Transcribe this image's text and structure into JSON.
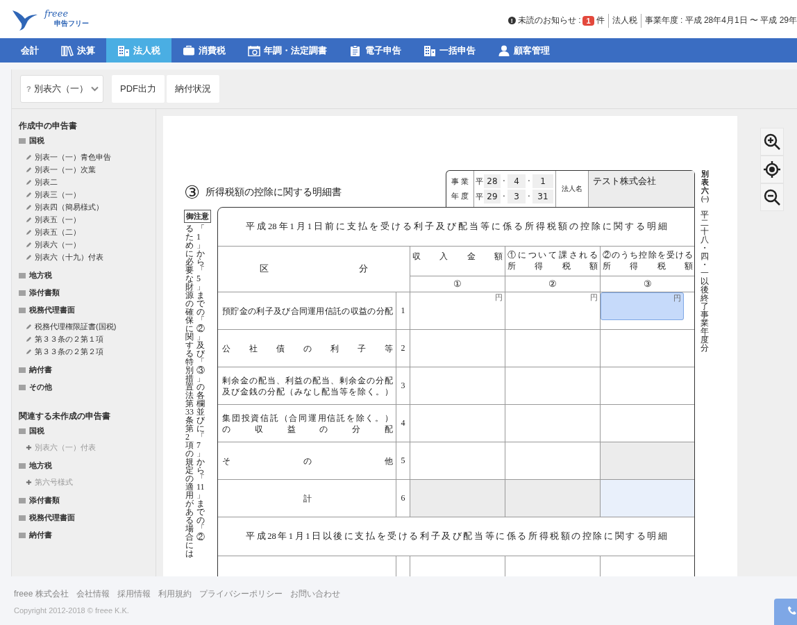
{
  "header": {
    "logo_script": "freee",
    "logo_text": "申告フリー",
    "notice_mark": "!",
    "notice_label": "未読のお知らせ :",
    "notice_count": "1",
    "notice_unit": "件",
    "tax_type": "法人税",
    "fiscal_year": "事業年度 : 平成 28年4月1日 〜 平成 29年"
  },
  "nav": [
    {
      "label": "会計",
      "selected": false
    },
    {
      "label": "決算",
      "selected": false
    },
    {
      "label": "法人税",
      "selected": true
    },
    {
      "label": "消費税",
      "selected": false
    },
    {
      "label": "年調・法定調書",
      "selected": false
    },
    {
      "label": "電子申告",
      "selected": false
    },
    {
      "label": "一括申告",
      "selected": false
    },
    {
      "label": "顧客管理",
      "selected": false
    }
  ],
  "toolbar": {
    "form_select": {
      "hint": "?",
      "value": "別表六（一）"
    },
    "buttons": [
      "PDF出力",
      "納付状況"
    ]
  },
  "sidebar": {
    "sections": [
      {
        "title": "作成中の申告書",
        "groups": [
          {
            "name": "国税",
            "items": [
              {
                "label": "別表一（一）青色申告",
                "kind": "edit"
              },
              {
                "label": "別表一（一）次葉",
                "kind": "edit"
              },
              {
                "label": "別表二",
                "kind": "edit"
              },
              {
                "label": "別表三（一）",
                "kind": "edit"
              },
              {
                "label": "別表四（簡易様式）",
                "kind": "edit"
              },
              {
                "label": "別表五（一）",
                "kind": "edit"
              },
              {
                "label": "別表五（二）",
                "kind": "edit"
              },
              {
                "label": "別表六（一）",
                "kind": "edit"
              },
              {
                "label": "別表六（十九）付表",
                "kind": "edit"
              }
            ]
          },
          {
            "name": "地方税"
          },
          {
            "name": "添付書類"
          },
          {
            "name": "税務代理書面",
            "items": [
              {
                "label": "税務代理権限証書(国税)",
                "kind": "edit"
              },
              {
                "label": "第３３条の２第１項",
                "kind": "edit"
              },
              {
                "label": "第３３条の２第２項",
                "kind": "edit"
              }
            ]
          },
          {
            "name": "納付書"
          },
          {
            "name": "その他"
          }
        ]
      },
      {
        "title": "関連する未作成の申告書",
        "groups": [
          {
            "name": "国税",
            "items": [
              {
                "label": "別表六（一）付表",
                "kind": "add"
              }
            ]
          },
          {
            "name": "地方税",
            "items": [
              {
                "label": "第六号様式",
                "kind": "add"
              }
            ]
          },
          {
            "name": "添付書類"
          },
          {
            "name": "税務代理書面"
          },
          {
            "name": "納付書"
          }
        ]
      }
    ]
  },
  "document": {
    "number": "③",
    "title": "所得税額の控除に関する明細書",
    "notice": "御注意",
    "note_columns": [
      "るために必要な財源の確保に関する特別措置法第33条第2項の規定の適用がある場合には",
      "「1」から「5」までの「②」及び「③」の各欄並びに「7」から「11」までの「②"
    ],
    "period_label": [
      "事業",
      "年度"
    ],
    "date_separator": "·",
    "dates": [
      {
        "era": "平",
        "year": "28",
        "month": "4",
        "day": "1"
      },
      {
        "era": "平",
        "year": "29",
        "month": "3",
        "day": "31"
      }
    ],
    "corp_label": "法人名",
    "corp_name": "テスト株式会社",
    "side_title": "別表六㈠",
    "side_note": "平二十八・四・一以後終了事業年度分",
    "sections": [
      {
        "heading": "平成28年1月1日前に支払を受ける利子及び配当等に係る所得税額の控除に関する明細",
        "columns_label": "区分",
        "columns": [
          {
            "lines": [
              "収入金額"
            ],
            "number": "①"
          },
          {
            "lines": [
              "①について課される",
              "所得税額"
            ],
            "number": "②"
          },
          {
            "lines": [
              "②のうち控除を受ける",
              "所得税額"
            ],
            "number": "③"
          }
        ],
        "rows": [
          {
            "no": "1",
            "kind": "item",
            "lines": [
              "預貯金の利子及び合同運用信託の収益の分配"
            ],
            "cells": [
              {
                "kind": "input",
                "unit": "円",
                "selected": false
              },
              {
                "kind": "input",
                "unit": "円",
                "selected": false
              },
              {
                "kind": "input",
                "unit": "円",
                "selected": true
              }
            ]
          },
          {
            "no": "2",
            "kind": "item",
            "lines": [
              "公社債の利子等"
            ],
            "cells": [
              {
                "kind": "input",
                "selected": false
              },
              {
                "kind": "input",
                "selected": false
              },
              {
                "kind": "input",
                "selected": false
              }
            ]
          },
          {
            "no": "3",
            "kind": "item",
            "lines": [
              "剰余金の配当、利益の配当、剰余金の分配",
              "及び金銭の分配（みなし配当等を除く。）"
            ],
            "cells": [
              {
                "kind": "input",
                "selected": false
              },
              {
                "kind": "input",
                "selected": false
              },
              {
                "kind": "input",
                "selected": false
              }
            ]
          },
          {
            "no": "4",
            "kind": "item",
            "lines": [
              "集団投資信託（合同運用信託を除く。）",
              "の収益の分配"
            ],
            "cells": [
              {
                "kind": "input",
                "selected": false
              },
              {
                "kind": "input",
                "selected": false
              },
              {
                "kind": "input",
                "selected": false
              }
            ]
          },
          {
            "no": "5",
            "kind": "item",
            "lines": [
              "その他"
            ],
            "cells": [
              {
                "kind": "input",
                "selected": false
              },
              {
                "kind": "input",
                "selected": false
              },
              {
                "kind": "disabled",
                "selected": false
              }
            ]
          },
          {
            "no": "6",
            "kind": "total",
            "lines": [
              "計"
            ],
            "cells": [
              {
                "kind": "disabled",
                "selected": false
              },
              {
                "kind": "disabled",
                "selected": false
              },
              {
                "kind": "total",
                "selected": false
              }
            ]
          }
        ]
      },
      {
        "heading": "平成28年1月1日以後に支払を受ける利子及び配当等に係る所得税額の控除に関する明細"
      }
    ]
  },
  "footer": {
    "links": [
      "freee 株式会社",
      "会社情報",
      "採用情報",
      "利用規約",
      "プライバシーポリシー",
      "お問い合わせ"
    ],
    "copyright": "Copyright 2012-2018 © freee K.K."
  }
}
